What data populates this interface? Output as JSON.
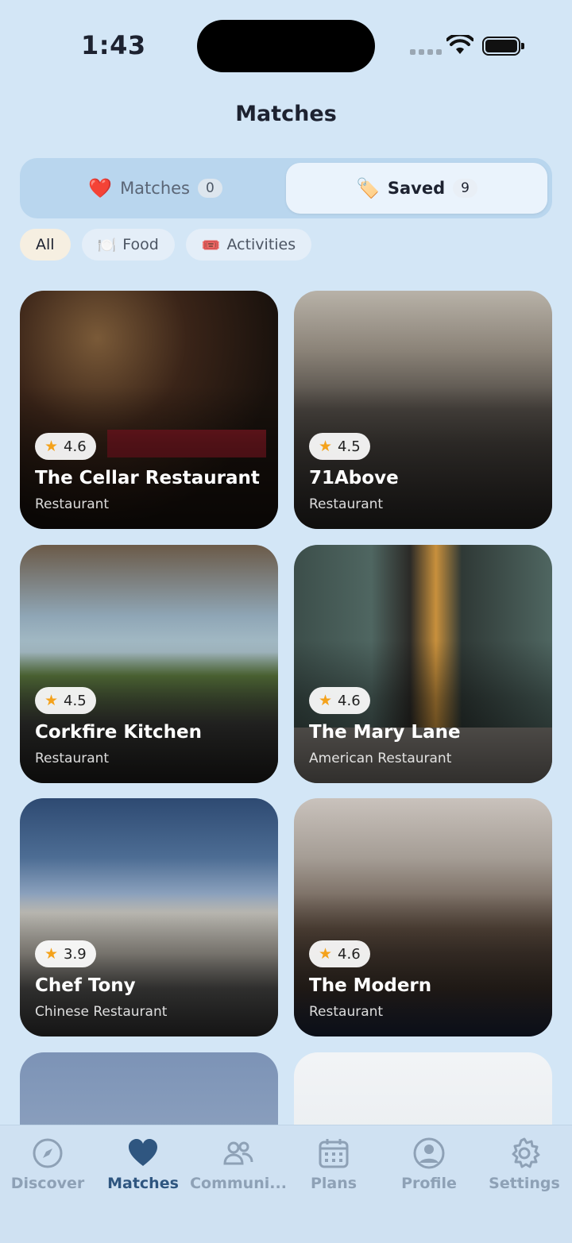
{
  "status": {
    "time": "1:43"
  },
  "header": {
    "title": "Matches"
  },
  "segments": [
    {
      "emoji": "❤️",
      "label": "Matches",
      "count": "0"
    },
    {
      "emoji": "🏷️",
      "label": "Saved",
      "count": "9"
    }
  ],
  "filters": [
    {
      "emoji": "",
      "label": "All"
    },
    {
      "emoji": "🍽️",
      "label": "Food"
    },
    {
      "emoji": "🎟️",
      "label": "Activities"
    }
  ],
  "cards": [
    {
      "rating": "4.6",
      "name": "The Cellar Restaurant",
      "type": "Restaurant"
    },
    {
      "rating": "4.5",
      "name": "71Above",
      "type": "Restaurant"
    },
    {
      "rating": "4.5",
      "name": "Corkfire Kitchen",
      "type": "Restaurant"
    },
    {
      "rating": "4.6",
      "name": "The Mary Lane",
      "type": "American Restaurant"
    },
    {
      "rating": "3.9",
      "name": "Chef Tony",
      "type": "Chinese Restaurant"
    },
    {
      "rating": "4.6",
      "name": "The Modern",
      "type": "Restaurant"
    }
  ],
  "tabs": [
    {
      "label": "Discover",
      "icon": "compass-icon"
    },
    {
      "label": "Matches",
      "icon": "heart-icon"
    },
    {
      "label": "Communi...",
      "icon": "people-icon"
    },
    {
      "label": "Plans",
      "icon": "calendar-icon"
    },
    {
      "label": "Profile",
      "icon": "person-circle-icon"
    },
    {
      "label": "Settings",
      "icon": "gear-icon"
    }
  ],
  "colors": {
    "accent": "#2f5680",
    "background": "#d3e6f6",
    "star": "#f4a21b"
  }
}
